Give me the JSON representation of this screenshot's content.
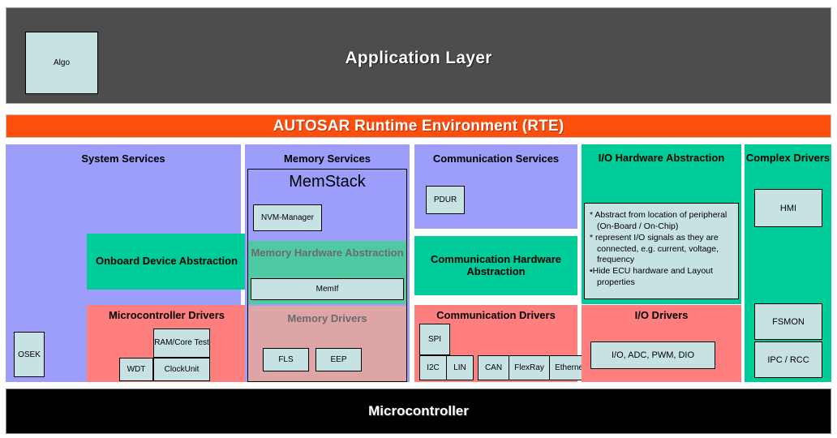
{
  "application_layer": {
    "title": "Application Layer",
    "algo_box": "Algo",
    "background_color": "#4d4d4d"
  },
  "rte": {
    "label": "AUTOSAR Runtime Environment (RTE)",
    "background_color": "#ff4f0f"
  },
  "colors": {
    "services_lavender": "#9d9dfb",
    "abstraction_green": "#00cc99",
    "drivers_salmon": "#ff7f7f",
    "module_box": "#c6e2e2",
    "memory_abstraction_muted_green": "#4fc9a4",
    "memory_drivers_muted_pink": "#dda5a5",
    "microcontroller": "#000000"
  },
  "columns": {
    "system_services": {
      "title": "System Services",
      "osek": "OSEK",
      "onboard_device_abstraction": "Onboard Device Abstraction",
      "microcontroller_drivers": {
        "title": "Microcontroller Drivers",
        "ram_core_test": "RAM/Core Test",
        "wdt": "WDT",
        "clock_unit": "ClockUnit"
      }
    },
    "memory": {
      "title": "Memory Services",
      "memstack": {
        "title": "MemStack",
        "nvm_manager": "NVM-Manager"
      },
      "memory_hardware_abstraction": {
        "title": "Memory Hardware Abstraction",
        "memif": "MemIf"
      },
      "memory_drivers": {
        "title": "Memory Drivers",
        "fls": "FLS",
        "eep": "EEP"
      }
    },
    "communication": {
      "title": "Communication Services",
      "pdur": "PDUR",
      "hardware_abstraction": "Communication Hardware Abstraction",
      "drivers": {
        "title": "Communication Drivers",
        "spi": "SPI",
        "bus_modules": [
          "I2C",
          "LIN",
          "CAN",
          "FlexRay",
          "Ethernet"
        ]
      }
    },
    "io": {
      "hardware_abstraction": {
        "title": "I/O Hardware Abstraction",
        "notes": [
          "* Abstract from location of peripheral (On-Board / On-Chip)",
          "* represent I/O signals as they are connected, e.g. current, voltage, frequency",
          "•Hide ECU hardware and Layout properties"
        ]
      },
      "drivers": {
        "title": "I/O Drivers",
        "module": "I/O, ADC, PWM, DIO"
      }
    },
    "complex_drivers": {
      "title": "Complex Drivers",
      "modules": [
        "HMI",
        "FSMON",
        "IPC / RCC"
      ]
    }
  },
  "microcontroller": {
    "label": "Microcontroller"
  }
}
